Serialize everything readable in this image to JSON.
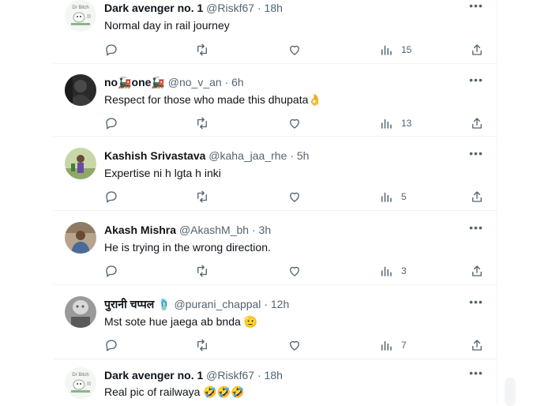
{
  "tweets": [
    {
      "name": "Dark avenger no. 1",
      "handle": "@Riskf67",
      "time": "18h",
      "text": "Normal day in rail journey",
      "emoji": "",
      "views": "15",
      "avatar": "cartoon-logo"
    },
    {
      "name": "no🚂one🚂",
      "handle": "@no_v_an",
      "time": "6h",
      "text": "Respect for those who made this dhupata",
      "emoji": "👌",
      "views": "13",
      "avatar": "dark-photo"
    },
    {
      "name": "Kashish Srivastava",
      "handle": "@kaha_jaa_rhe",
      "time": "5h",
      "text": "Expertise ni h lgta h inki",
      "emoji": "",
      "views": "5",
      "avatar": "outdoor-photo"
    },
    {
      "name": "Akash Mishra",
      "handle": "@AkashM_bh",
      "time": "3h",
      "text": "He is trying in the wrong direction.",
      "emoji": "",
      "views": "3",
      "avatar": "room-photo"
    },
    {
      "name": "पुरानी चप्पल 🩴",
      "handle": "@purani_chappal",
      "time": "12h",
      "text": "Mst sote hue jaega ab bnda",
      "emoji": "🫡",
      "views": "7",
      "avatar": "gray-photo"
    },
    {
      "name": "Dark avenger no. 1",
      "handle": "@Riskf67",
      "time": "18h",
      "text": "Real pic of railwaya",
      "emoji": "🤣🤣🤣",
      "views": "",
      "avatar": "cartoon-logo"
    }
  ],
  "separator": "·",
  "more_glyph": "•••",
  "icons": {
    "reply": "reply-icon",
    "retweet": "retweet-icon",
    "like": "like-icon",
    "views": "views-icon",
    "share": "share-icon"
  },
  "colors": {
    "text": "#0f1419",
    "secondary": "#536471",
    "border": "#eff3f4"
  }
}
